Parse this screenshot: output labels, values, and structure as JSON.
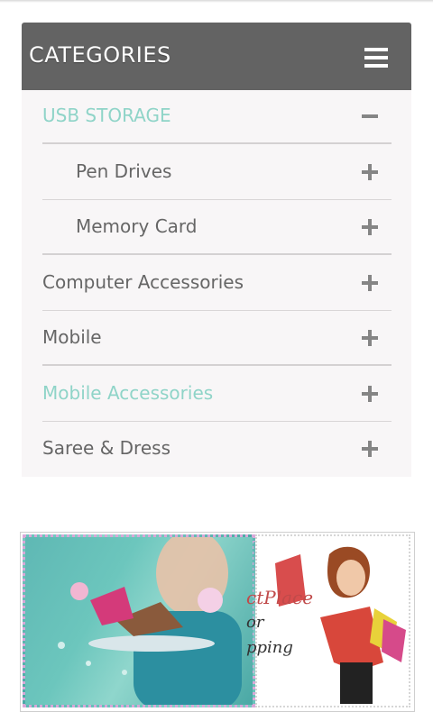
{
  "panel": {
    "title": "CATEGORIES",
    "accent_color": "#8fd4c8",
    "header_color": "#636363",
    "items": [
      {
        "label": "USB STORAGE",
        "level": "top",
        "active": true,
        "toggle": "minus-icon"
      },
      {
        "label": "Pen Drives",
        "level": "sub",
        "active": false,
        "toggle": "plus-icon"
      },
      {
        "label": "Memory Card",
        "level": "sub",
        "active": false,
        "toggle": "plus-icon"
      },
      {
        "label": "Computer Accessories",
        "level": "top",
        "active": false,
        "toggle": "plus-icon"
      },
      {
        "label": "Mobile",
        "level": "top",
        "active": false,
        "toggle": "plus-icon"
      },
      {
        "label": "Mobile Accessories",
        "level": "top",
        "active": true,
        "toggle": "plus-icon"
      },
      {
        "label": "Saree & Dress",
        "level": "top",
        "active": false,
        "toggle": "plus-icon"
      }
    ]
  },
  "banner": {
    "text_line1": "ctPlace",
    "text_line2": "or",
    "text_line3": "pping"
  }
}
